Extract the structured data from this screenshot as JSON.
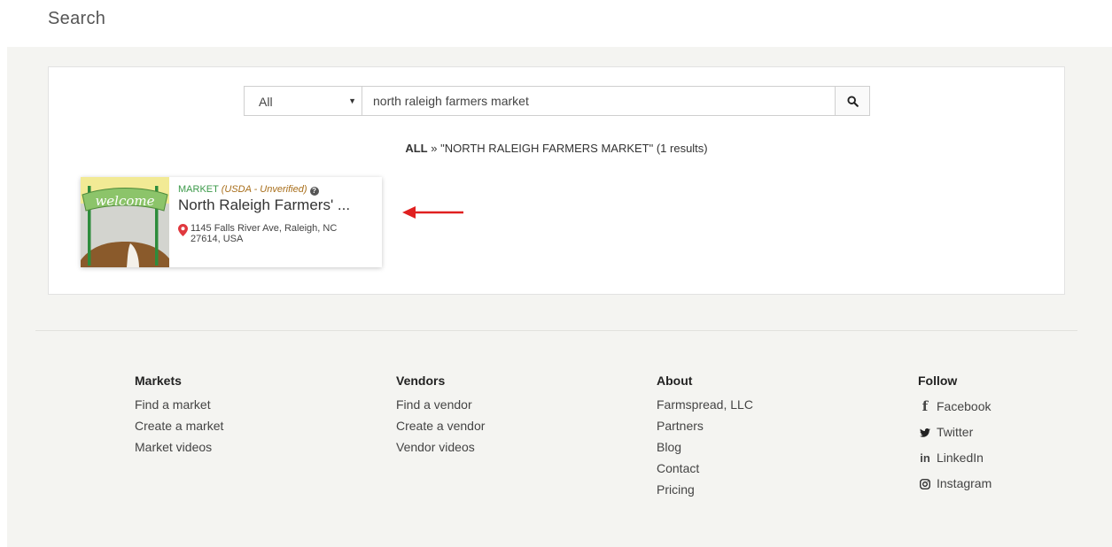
{
  "page": {
    "title": "Search"
  },
  "search": {
    "category_selected": "All",
    "query": "north raleigh farmers market"
  },
  "results": {
    "crumb_all": "ALL",
    "crumb_sep": " » ",
    "crumb_query": "\"NORTH RALEIGH FARMERS MARKET\" (1 results)",
    "items": [
      {
        "type": "MARKET",
        "status": "(USDA - Unverified)",
        "name": "North Raleigh Farmers' ...",
        "address_line1": "1145 Falls River Ave, Raleigh, NC",
        "address_line2": "27614, USA",
        "thumb_text": "welcome"
      }
    ]
  },
  "footer": {
    "markets": {
      "heading": "Markets",
      "links": [
        "Find a market",
        "Create a market",
        "Market videos"
      ]
    },
    "vendors": {
      "heading": "Vendors",
      "links": [
        "Find a vendor",
        "Create a vendor",
        "Vendor videos"
      ]
    },
    "about": {
      "heading": "About",
      "links": [
        "Farmspread, LLC",
        "Partners",
        "Blog",
        "Contact",
        "Pricing"
      ]
    },
    "follow": {
      "heading": "Follow",
      "links": [
        "Facebook",
        "Twitter",
        "LinkedIn",
        "Instagram"
      ]
    }
  },
  "colors": {
    "band": "#f4f4f1",
    "market_type": "#3c9a4a",
    "usda_status": "#a86e1a",
    "pin": "#e0383e",
    "arrow": "#e02020"
  }
}
